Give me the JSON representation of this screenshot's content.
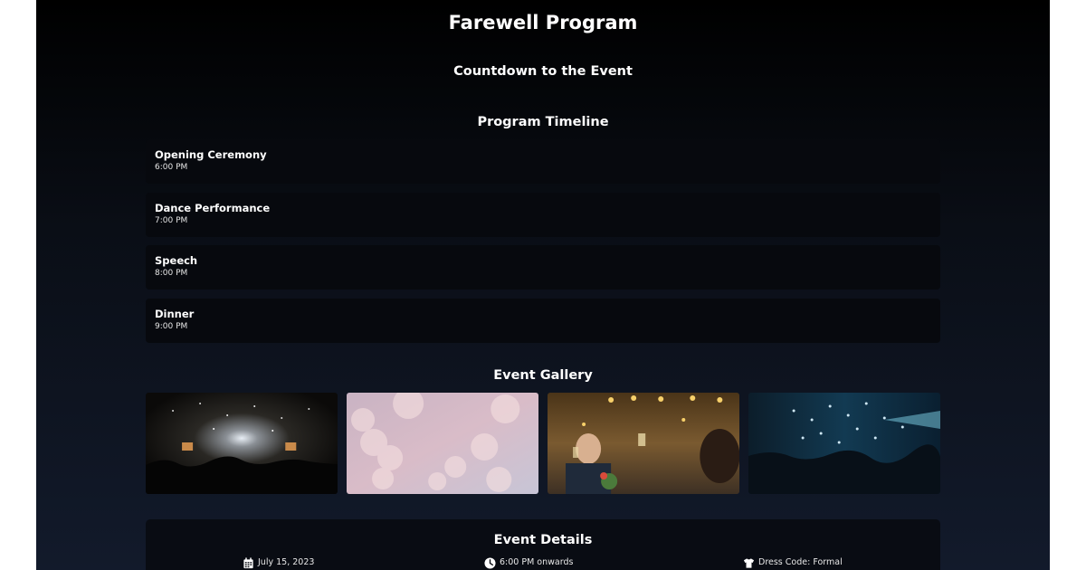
{
  "page": {
    "title": "Farewell Program"
  },
  "countdown": {
    "heading": "Countdown to the Event"
  },
  "timeline": {
    "heading": "Program Timeline",
    "items": [
      {
        "name": "Opening Ceremony",
        "time": "6:00 PM"
      },
      {
        "name": "Dance Performance",
        "time": "7:00 PM"
      },
      {
        "name": "Speech",
        "time": "8:00 PM"
      },
      {
        "name": "Dinner",
        "time": "9:00 PM"
      }
    ]
  },
  "gallery": {
    "heading": "Event Gallery",
    "photos": [
      {
        "icon": "concert-crowd-photo"
      },
      {
        "icon": "bokeh-lights-photo"
      },
      {
        "icon": "dinner-toast-photo"
      },
      {
        "icon": "confetti-party-photo"
      }
    ]
  },
  "details": {
    "heading": "Event Details",
    "date": {
      "icon": "calendar-icon",
      "text": "July 15, 2023"
    },
    "time": {
      "icon": "clock-icon",
      "text": "6:00 PM onwards"
    },
    "dress": {
      "icon": "shirt-icon",
      "text": "Dress Code: Formal"
    }
  }
}
